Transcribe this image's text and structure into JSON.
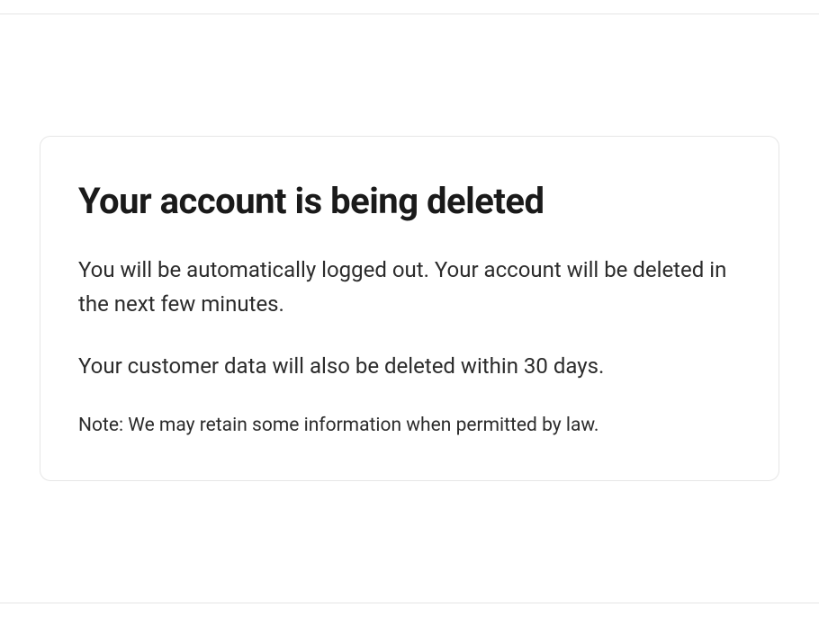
{
  "card": {
    "title": "Your account is being deleted",
    "paragraph1": "You will be automatically logged out. Your account will be deleted in the next few minutes.",
    "paragraph2": "Your customer data will also be deleted within 30 days.",
    "note": "Note: We may retain some information when permitted by law."
  }
}
